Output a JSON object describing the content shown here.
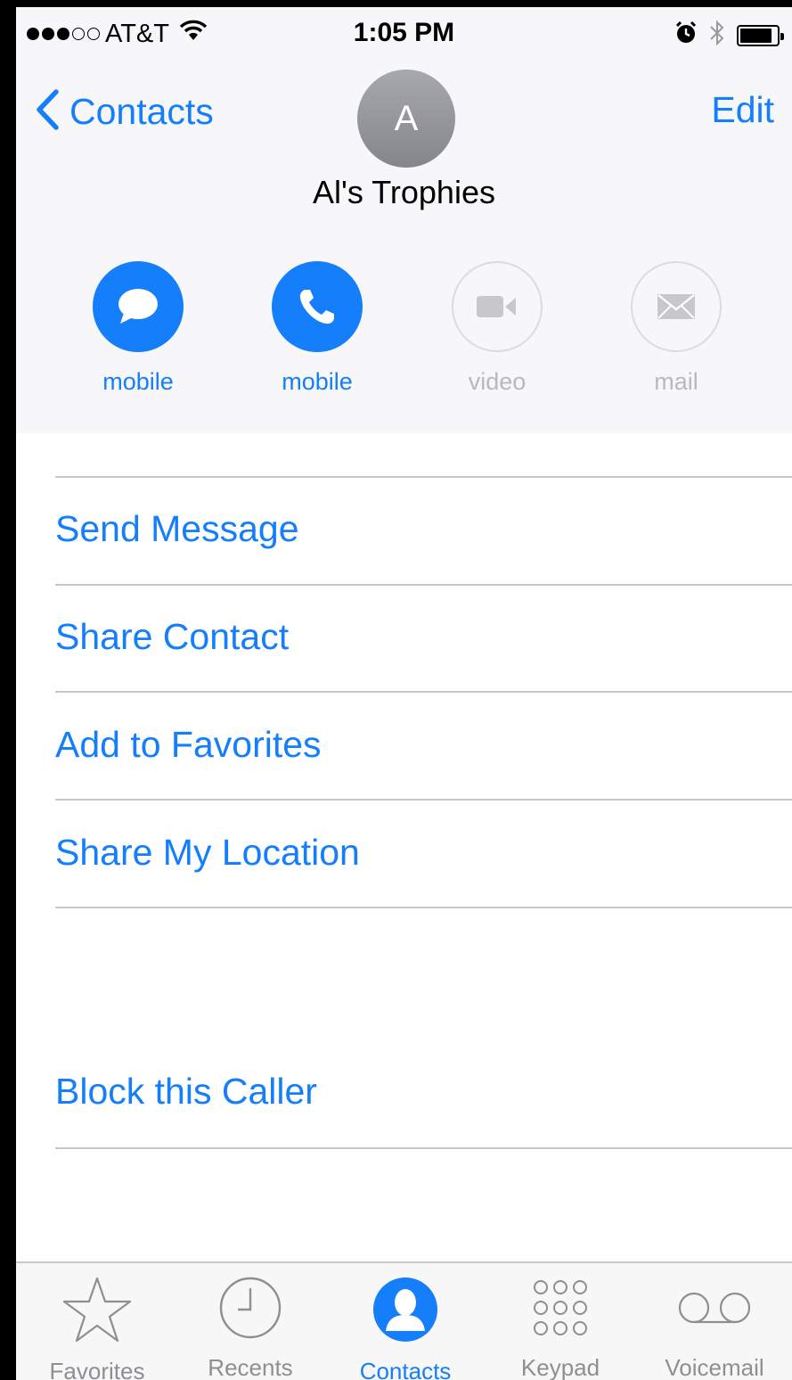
{
  "status_bar": {
    "carrier": "AT&T",
    "time": "1:05 PM"
  },
  "nav": {
    "back_label": "Contacts",
    "edit_label": "Edit"
  },
  "contact": {
    "initial": "A",
    "name": "Al's Trophies"
  },
  "actions": [
    {
      "label": "mobile",
      "icon": "message-bubble-icon",
      "enabled": true
    },
    {
      "label": "mobile",
      "icon": "phone-icon",
      "enabled": true
    },
    {
      "label": "video",
      "icon": "video-camera-icon",
      "enabled": false
    },
    {
      "label": "mail",
      "icon": "envelope-icon",
      "enabled": false
    }
  ],
  "list_items": {
    "send_message": "Send Message",
    "share_contact": "Share Contact",
    "add_favorites": "Add to Favorites",
    "share_location": "Share My Location",
    "block_caller": "Block this Caller"
  },
  "tabs": [
    {
      "label": "Favorites",
      "icon": "star-icon",
      "active": false
    },
    {
      "label": "Recents",
      "icon": "clock-icon",
      "active": false
    },
    {
      "label": "Contacts",
      "icon": "contacts-person-icon",
      "active": true
    },
    {
      "label": "Keypad",
      "icon": "keypad-icon",
      "active": false
    },
    {
      "label": "Voicemail",
      "icon": "voicemail-icon",
      "active": false
    }
  ],
  "colors": {
    "accent": "#147efb",
    "disabled": "#b9b9bd",
    "header_bg": "#f7f7f9"
  }
}
